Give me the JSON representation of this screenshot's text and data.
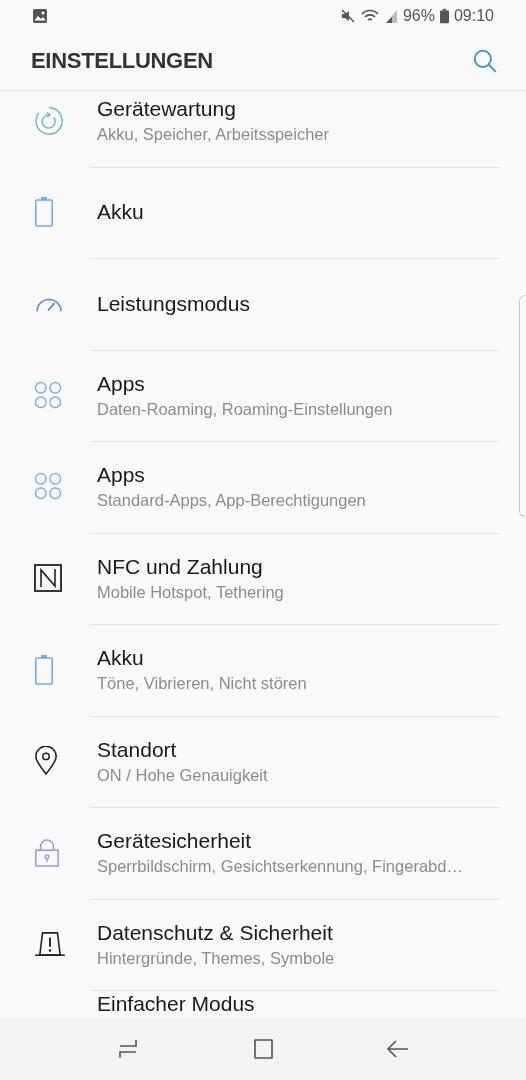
{
  "status_bar": {
    "battery_percent": "96%",
    "time": "09:10"
  },
  "header": {
    "title": "EINSTELLUNGEN"
  },
  "items": [
    {
      "kind": "maintenance",
      "title": "Gerätewartung",
      "subtitle": "Akku, Speicher, Arbeitsspeicher"
    },
    {
      "kind": "battery",
      "title": "Akku"
    },
    {
      "kind": "gauge",
      "title": "Leistungsmodus"
    },
    {
      "kind": "apps",
      "title": "Apps",
      "subtitle": "Daten-Roaming, Roaming-Einstellungen"
    },
    {
      "kind": "apps",
      "title": "Apps",
      "subtitle": "Standard-Apps, App-Berechtigungen"
    },
    {
      "kind": "nfc",
      "title": "NFC und Zahlung",
      "subtitle": "Mobile Hotspot, Tethering"
    },
    {
      "kind": "battery",
      "title": "Akku",
      "subtitle": "Töne, Vibrieren, Nicht stören"
    },
    {
      "kind": "location",
      "title": "Standort",
      "subtitle": "ON / Hohe Genauigkeit"
    },
    {
      "kind": "lock",
      "title": "Gerätesicherheit",
      "subtitle": "Sperrbildschirm, Gesichtserkennung, Fingerabd…"
    },
    {
      "kind": "warning",
      "title": "Datenschutz & Sicherheit",
      "subtitle": "Hintergründe, Themes, Symbole"
    },
    {
      "kind": "none",
      "title": "Einfacher Modus"
    }
  ]
}
